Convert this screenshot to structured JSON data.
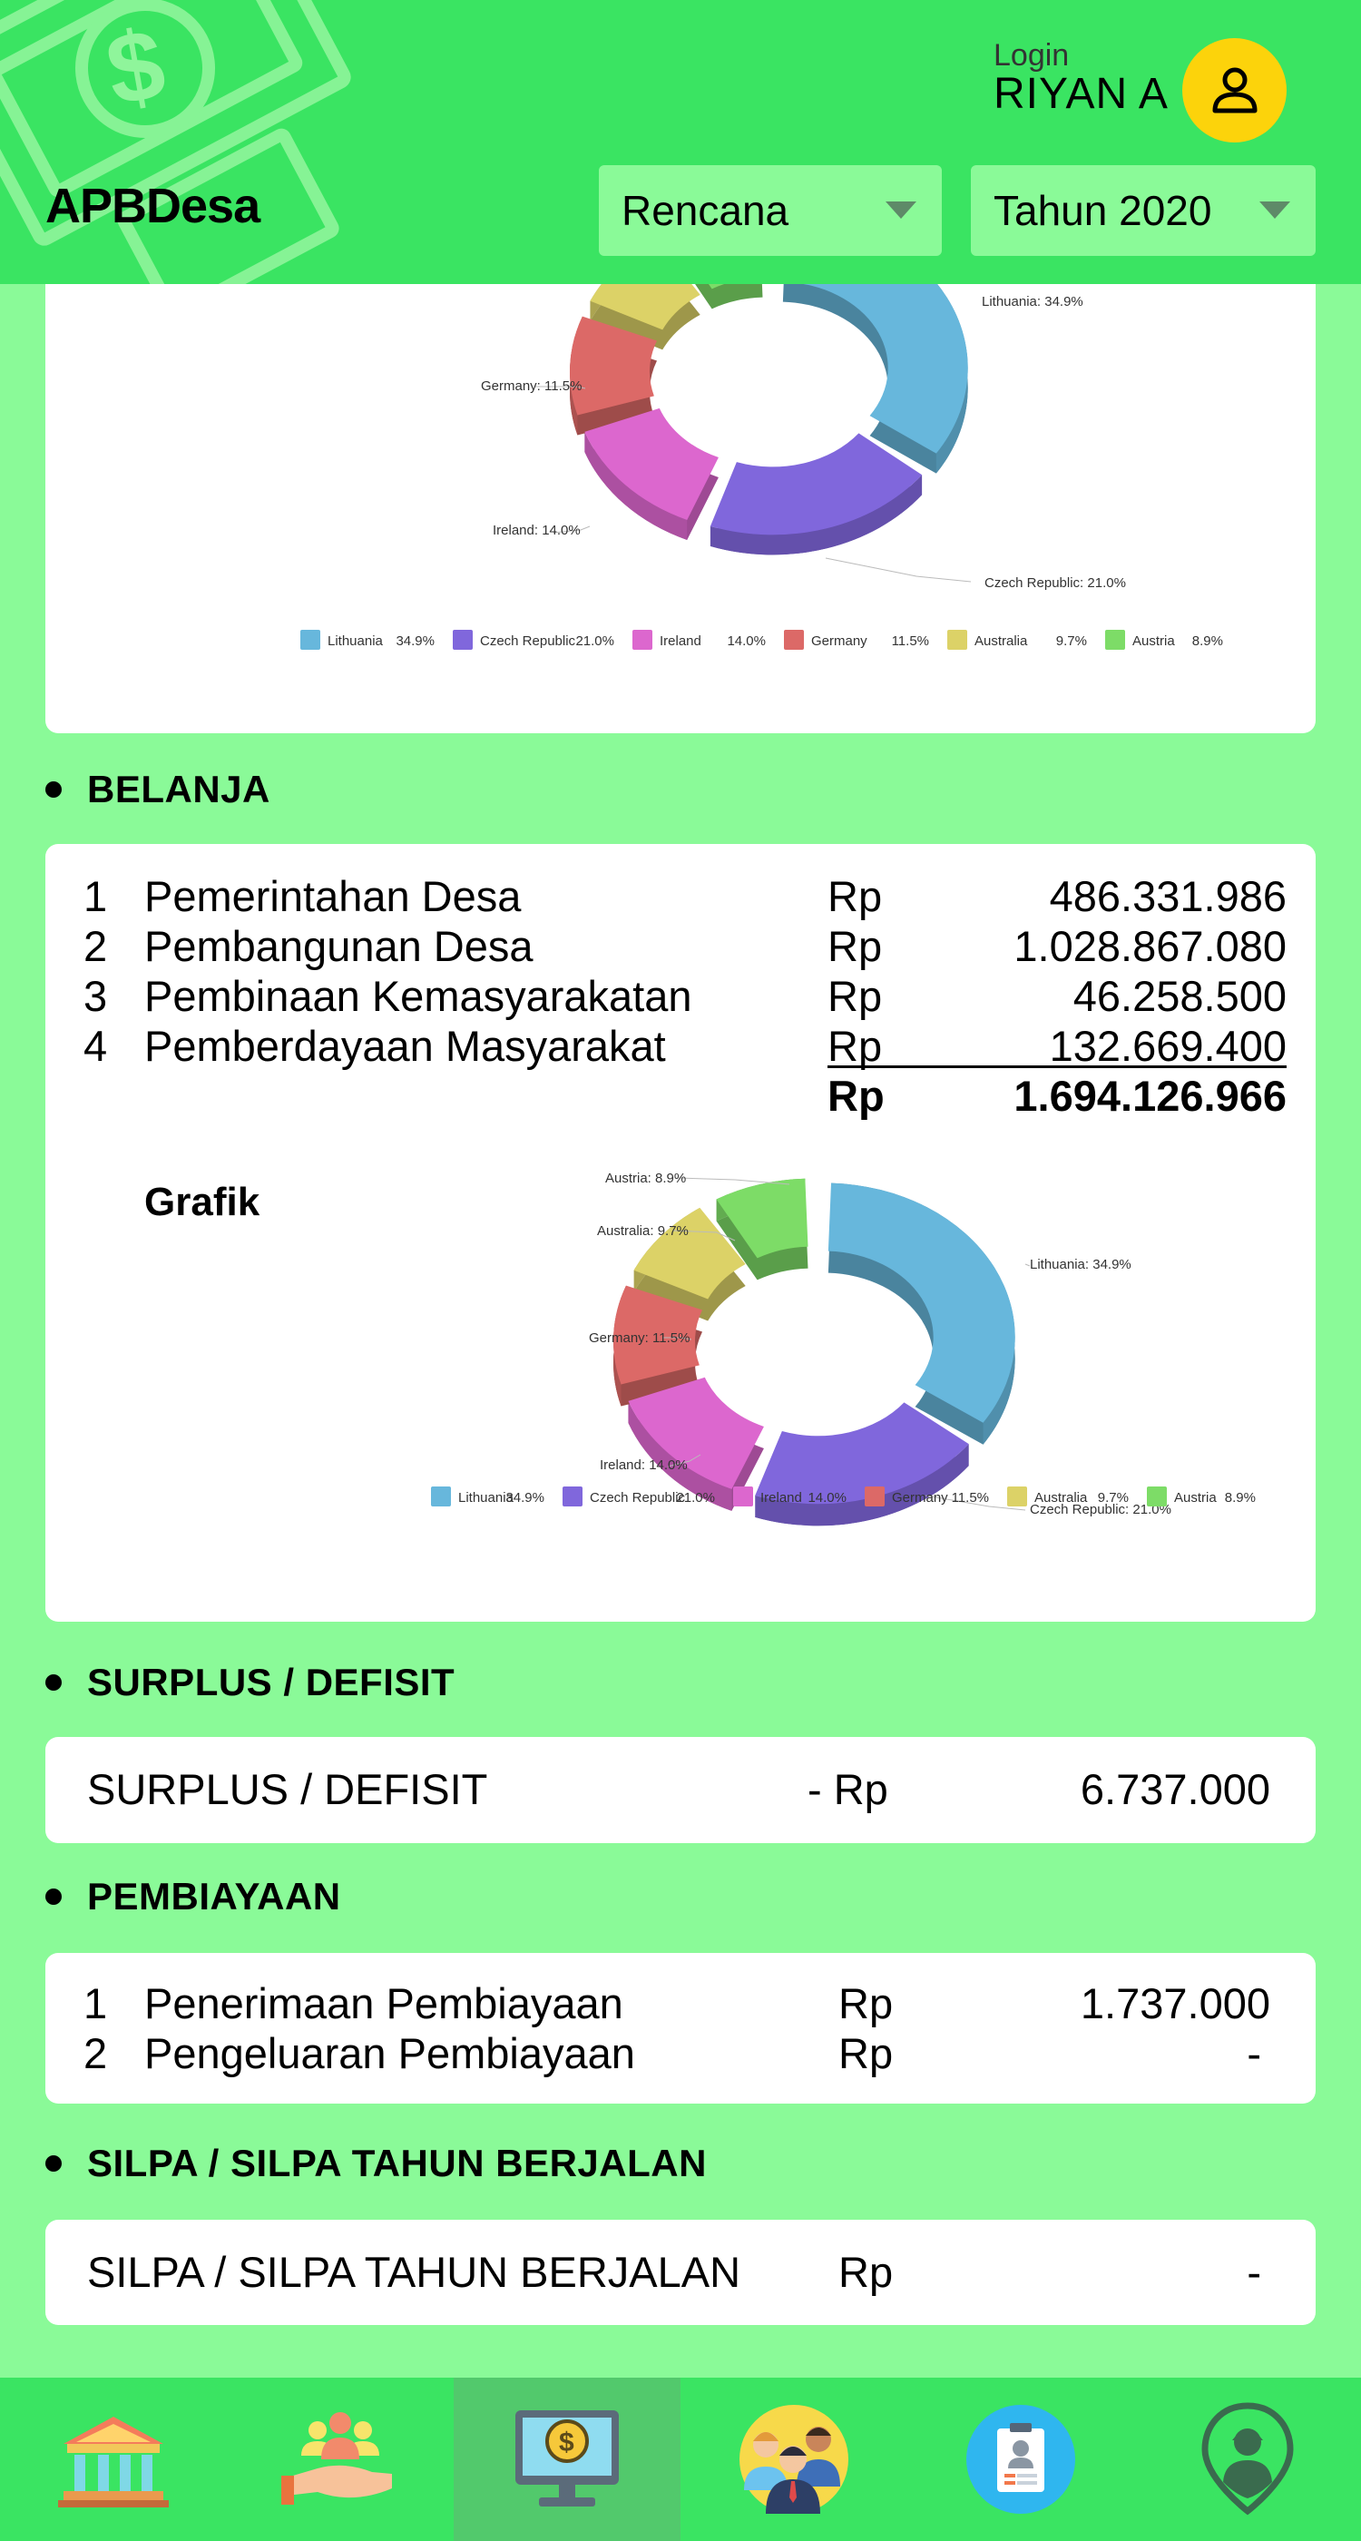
{
  "header": {
    "app_title": "APBDesa",
    "login_label": "Login",
    "user_name": "RIYAN A",
    "plan_select": "Rencana",
    "year_select": "Tahun 2020"
  },
  "chart_top": {
    "labels": {
      "lithuania": "Lithuania: 34.9%",
      "germany": "Germany: 11.5%",
      "ireland": "Ireland: 14.0%",
      "czech": "Czech Republic: 21.0%"
    },
    "legend": [
      {
        "name": "Lithuania",
        "value": "34.9%"
      },
      {
        "name": "Czech Republic",
        "value": "21.0%"
      },
      {
        "name": "Ireland",
        "value": "14.0%"
      },
      {
        "name": "Germany",
        "value": "11.5%"
      },
      {
        "name": "Australia",
        "value": "9.7%"
      },
      {
        "name": "Austria",
        "value": "8.9%"
      }
    ]
  },
  "belanja": {
    "title": "BELANJA",
    "rows": [
      {
        "no": "1",
        "label": "Pemerintahan Desa",
        "currency": "Rp",
        "amount": "486.331.986"
      },
      {
        "no": "2",
        "label": "Pembangunan Desa",
        "currency": "Rp",
        "amount": "1.028.867.080"
      },
      {
        "no": "3",
        "label": "Pembinaan Kemasyarakatan",
        "currency": "Rp",
        "amount": "46.258.500"
      },
      {
        "no": "4",
        "label": "Pemberdayaan Masyarakat",
        "currency": "Rp",
        "amount": "132.669.400"
      }
    ],
    "total_currency": "Rp",
    "total_amount": "1.694.126.966",
    "chart_label": "Grafik",
    "chart_labels": {
      "austria": "Austria: 8.9%",
      "australia": "Australia: 9.7%",
      "germany": "Germany: 11.5%",
      "ireland": "Ireland: 14.0%",
      "lithuania": "Lithuania: 34.9%",
      "czech": "Czech Republic: 21.0%"
    },
    "legend": [
      {
        "name": "Lithuania",
        "value": "34.9%"
      },
      {
        "name": "Czech Republic",
        "value": "21.0%"
      },
      {
        "name": "Ireland",
        "value": "14.0%"
      },
      {
        "name": "Germany",
        "value": "11.5%"
      },
      {
        "name": "Australia",
        "value": "9.7%"
      },
      {
        "name": "Austria",
        "value": "8.9%"
      }
    ]
  },
  "surplus": {
    "title": "SURPLUS / DEFISIT",
    "label": "SURPLUS / DEFISIT",
    "currency": "- Rp",
    "amount": "6.737.000"
  },
  "pembiayaan": {
    "title": "PEMBIAYAAN",
    "rows": [
      {
        "no": "1",
        "label": "Penerimaan Pembiayaan",
        "currency": "Rp",
        "amount": "1.737.000"
      },
      {
        "no": "2",
        "label": "Pengeluaran Pembiayaan",
        "currency": "Rp",
        "amount": "-"
      }
    ]
  },
  "silpa": {
    "title": "SILPA / SILPA TAHUN BERJALAN",
    "label": "SILPA / SILPA TAHUN BERJALAN",
    "currency": "Rp",
    "amount": "-"
  },
  "nav": [
    {
      "icon": "bank-icon"
    },
    {
      "icon": "community-hand-icon"
    },
    {
      "icon": "budget-monitor-icon"
    },
    {
      "icon": "people-group-icon"
    },
    {
      "icon": "profile-card-icon"
    },
    {
      "icon": "location-person-icon"
    }
  ],
  "chart_colors": {
    "Lithuania": "#67b7dc",
    "Czech Republic": "#8067dc",
    "Ireland": "#dc67ce",
    "Germany": "#dc6967",
    "Australia": "#dcd267",
    "Austria": "#7ddc67"
  },
  "chart_data": [
    {
      "type": "pie",
      "categories": [
        "Lithuania",
        "Czech Republic",
        "Ireland",
        "Germany",
        "Australia",
        "Austria"
      ],
      "values": [
        34.9,
        21.0,
        14.0,
        11.5,
        9.7,
        8.9
      ]
    },
    {
      "type": "pie",
      "categories": [
        "Lithuania",
        "Czech Republic",
        "Ireland",
        "Germany",
        "Australia",
        "Austria"
      ],
      "values": [
        34.9,
        21.0,
        14.0,
        11.5,
        9.7,
        8.9
      ]
    }
  ]
}
